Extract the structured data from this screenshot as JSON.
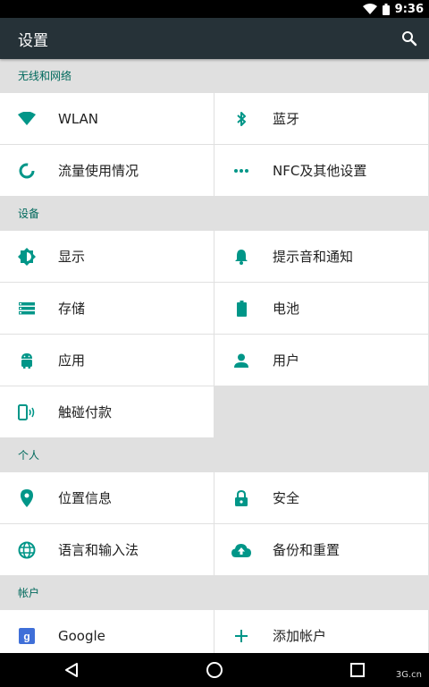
{
  "status_bar": {
    "time": "9:36"
  },
  "app_bar": {
    "title": "设置",
    "search_icon": "search-icon"
  },
  "sections": {
    "wireless": {
      "header": "无线和网络",
      "items": [
        {
          "label": "WLAN",
          "icon": "wifi-icon"
        },
        {
          "label": "蓝牙",
          "icon": "bluetooth-icon"
        },
        {
          "label": "流量使用情况",
          "icon": "data-usage-icon"
        },
        {
          "label": "NFC及其他设置",
          "icon": "more-icon"
        }
      ]
    },
    "device": {
      "header": "设备",
      "items": [
        {
          "label": "显示",
          "icon": "brightness-icon"
        },
        {
          "label": "提示音和通知",
          "icon": "bell-icon"
        },
        {
          "label": "存储",
          "icon": "storage-icon"
        },
        {
          "label": "电池",
          "icon": "battery-icon"
        },
        {
          "label": "应用",
          "icon": "android-icon"
        },
        {
          "label": "用户",
          "icon": "person-icon"
        },
        {
          "label": "触碰付款",
          "icon": "tap-pay-icon"
        }
      ]
    },
    "personal": {
      "header": "个人",
      "items": [
        {
          "label": "位置信息",
          "icon": "location-icon"
        },
        {
          "label": "安全",
          "icon": "lock-icon"
        },
        {
          "label": "语言和输入法",
          "icon": "globe-icon"
        },
        {
          "label": "备份和重置",
          "icon": "cloud-upload-icon"
        }
      ]
    },
    "accounts": {
      "header": "帐户",
      "items": [
        {
          "label": "Google",
          "icon": "google-icon"
        },
        {
          "label": "添加帐户",
          "icon": "plus-icon"
        }
      ]
    }
  },
  "watermark": {
    "text": "3G.cn"
  },
  "colors": {
    "accent": "#009688",
    "app_bar": "#263238",
    "section_bg": "#e0e0e0",
    "section_text": "#00695c"
  }
}
